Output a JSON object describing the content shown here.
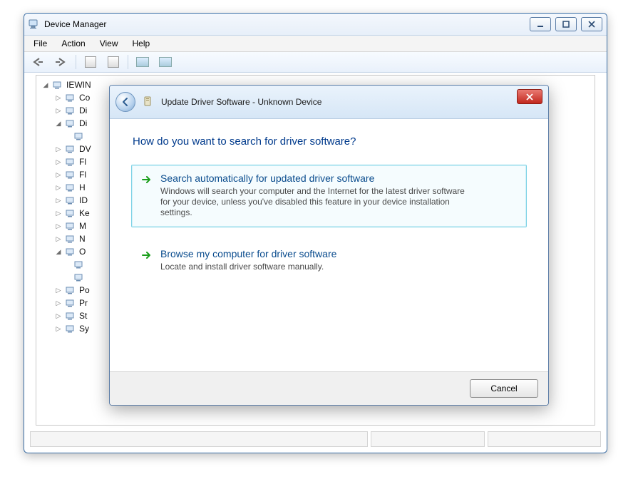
{
  "dm": {
    "title": "Device Manager",
    "menu": {
      "file": "File",
      "action": "Action",
      "view": "View",
      "help": "Help"
    },
    "tree": {
      "root": "IEWIN",
      "items": [
        {
          "label": "Co"
        },
        {
          "label": "Di"
        },
        {
          "label": "Di",
          "expanded": true,
          "children": [
            {
              "label": ""
            }
          ]
        },
        {
          "label": "DV"
        },
        {
          "label": "Fl"
        },
        {
          "label": "Fl"
        },
        {
          "label": "H"
        },
        {
          "label": "ID"
        },
        {
          "label": "Ke"
        },
        {
          "label": "M"
        },
        {
          "label": "N"
        },
        {
          "label": "O",
          "expanded": true,
          "children": [
            {
              "label": ""
            },
            {
              "label": ""
            }
          ]
        },
        {
          "label": "Po"
        },
        {
          "label": "Pr"
        },
        {
          "label": "St"
        },
        {
          "label": "Sy"
        }
      ]
    }
  },
  "dialog": {
    "title": "Update Driver Software - Unknown Device",
    "heading": "How do you want to search for driver software?",
    "option1": {
      "title": "Search automatically for updated driver software",
      "desc": "Windows will search your computer and the Internet for the latest driver software for your device, unless you've disabled this feature in your device installation settings."
    },
    "option2": {
      "title": "Browse my computer for driver software",
      "desc": "Locate and install driver software manually."
    },
    "cancel": "Cancel"
  }
}
